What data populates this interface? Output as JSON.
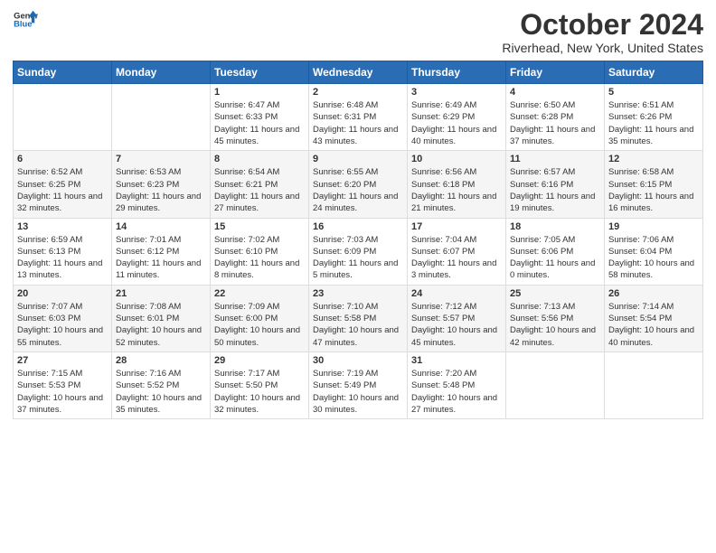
{
  "header": {
    "logo_line1": "General",
    "logo_line2": "Blue",
    "month": "October 2024",
    "location": "Riverhead, New York, United States"
  },
  "weekdays": [
    "Sunday",
    "Monday",
    "Tuesday",
    "Wednesday",
    "Thursday",
    "Friday",
    "Saturday"
  ],
  "weeks": [
    [
      {
        "day": "",
        "info": ""
      },
      {
        "day": "",
        "info": ""
      },
      {
        "day": "1",
        "info": "Sunrise: 6:47 AM\nSunset: 6:33 PM\nDaylight: 11 hours and 45 minutes."
      },
      {
        "day": "2",
        "info": "Sunrise: 6:48 AM\nSunset: 6:31 PM\nDaylight: 11 hours and 43 minutes."
      },
      {
        "day": "3",
        "info": "Sunrise: 6:49 AM\nSunset: 6:29 PM\nDaylight: 11 hours and 40 minutes."
      },
      {
        "day": "4",
        "info": "Sunrise: 6:50 AM\nSunset: 6:28 PM\nDaylight: 11 hours and 37 minutes."
      },
      {
        "day": "5",
        "info": "Sunrise: 6:51 AM\nSunset: 6:26 PM\nDaylight: 11 hours and 35 minutes."
      }
    ],
    [
      {
        "day": "6",
        "info": "Sunrise: 6:52 AM\nSunset: 6:25 PM\nDaylight: 11 hours and 32 minutes."
      },
      {
        "day": "7",
        "info": "Sunrise: 6:53 AM\nSunset: 6:23 PM\nDaylight: 11 hours and 29 minutes."
      },
      {
        "day": "8",
        "info": "Sunrise: 6:54 AM\nSunset: 6:21 PM\nDaylight: 11 hours and 27 minutes."
      },
      {
        "day": "9",
        "info": "Sunrise: 6:55 AM\nSunset: 6:20 PM\nDaylight: 11 hours and 24 minutes."
      },
      {
        "day": "10",
        "info": "Sunrise: 6:56 AM\nSunset: 6:18 PM\nDaylight: 11 hours and 21 minutes."
      },
      {
        "day": "11",
        "info": "Sunrise: 6:57 AM\nSunset: 6:16 PM\nDaylight: 11 hours and 19 minutes."
      },
      {
        "day": "12",
        "info": "Sunrise: 6:58 AM\nSunset: 6:15 PM\nDaylight: 11 hours and 16 minutes."
      }
    ],
    [
      {
        "day": "13",
        "info": "Sunrise: 6:59 AM\nSunset: 6:13 PM\nDaylight: 11 hours and 13 minutes."
      },
      {
        "day": "14",
        "info": "Sunrise: 7:01 AM\nSunset: 6:12 PM\nDaylight: 11 hours and 11 minutes."
      },
      {
        "day": "15",
        "info": "Sunrise: 7:02 AM\nSunset: 6:10 PM\nDaylight: 11 hours and 8 minutes."
      },
      {
        "day": "16",
        "info": "Sunrise: 7:03 AM\nSunset: 6:09 PM\nDaylight: 11 hours and 5 minutes."
      },
      {
        "day": "17",
        "info": "Sunrise: 7:04 AM\nSunset: 6:07 PM\nDaylight: 11 hours and 3 minutes."
      },
      {
        "day": "18",
        "info": "Sunrise: 7:05 AM\nSunset: 6:06 PM\nDaylight: 11 hours and 0 minutes."
      },
      {
        "day": "19",
        "info": "Sunrise: 7:06 AM\nSunset: 6:04 PM\nDaylight: 10 hours and 58 minutes."
      }
    ],
    [
      {
        "day": "20",
        "info": "Sunrise: 7:07 AM\nSunset: 6:03 PM\nDaylight: 10 hours and 55 minutes."
      },
      {
        "day": "21",
        "info": "Sunrise: 7:08 AM\nSunset: 6:01 PM\nDaylight: 10 hours and 52 minutes."
      },
      {
        "day": "22",
        "info": "Sunrise: 7:09 AM\nSunset: 6:00 PM\nDaylight: 10 hours and 50 minutes."
      },
      {
        "day": "23",
        "info": "Sunrise: 7:10 AM\nSunset: 5:58 PM\nDaylight: 10 hours and 47 minutes."
      },
      {
        "day": "24",
        "info": "Sunrise: 7:12 AM\nSunset: 5:57 PM\nDaylight: 10 hours and 45 minutes."
      },
      {
        "day": "25",
        "info": "Sunrise: 7:13 AM\nSunset: 5:56 PM\nDaylight: 10 hours and 42 minutes."
      },
      {
        "day": "26",
        "info": "Sunrise: 7:14 AM\nSunset: 5:54 PM\nDaylight: 10 hours and 40 minutes."
      }
    ],
    [
      {
        "day": "27",
        "info": "Sunrise: 7:15 AM\nSunset: 5:53 PM\nDaylight: 10 hours and 37 minutes."
      },
      {
        "day": "28",
        "info": "Sunrise: 7:16 AM\nSunset: 5:52 PM\nDaylight: 10 hours and 35 minutes."
      },
      {
        "day": "29",
        "info": "Sunrise: 7:17 AM\nSunset: 5:50 PM\nDaylight: 10 hours and 32 minutes."
      },
      {
        "day": "30",
        "info": "Sunrise: 7:19 AM\nSunset: 5:49 PM\nDaylight: 10 hours and 30 minutes."
      },
      {
        "day": "31",
        "info": "Sunrise: 7:20 AM\nSunset: 5:48 PM\nDaylight: 10 hours and 27 minutes."
      },
      {
        "day": "",
        "info": ""
      },
      {
        "day": "",
        "info": ""
      }
    ]
  ]
}
